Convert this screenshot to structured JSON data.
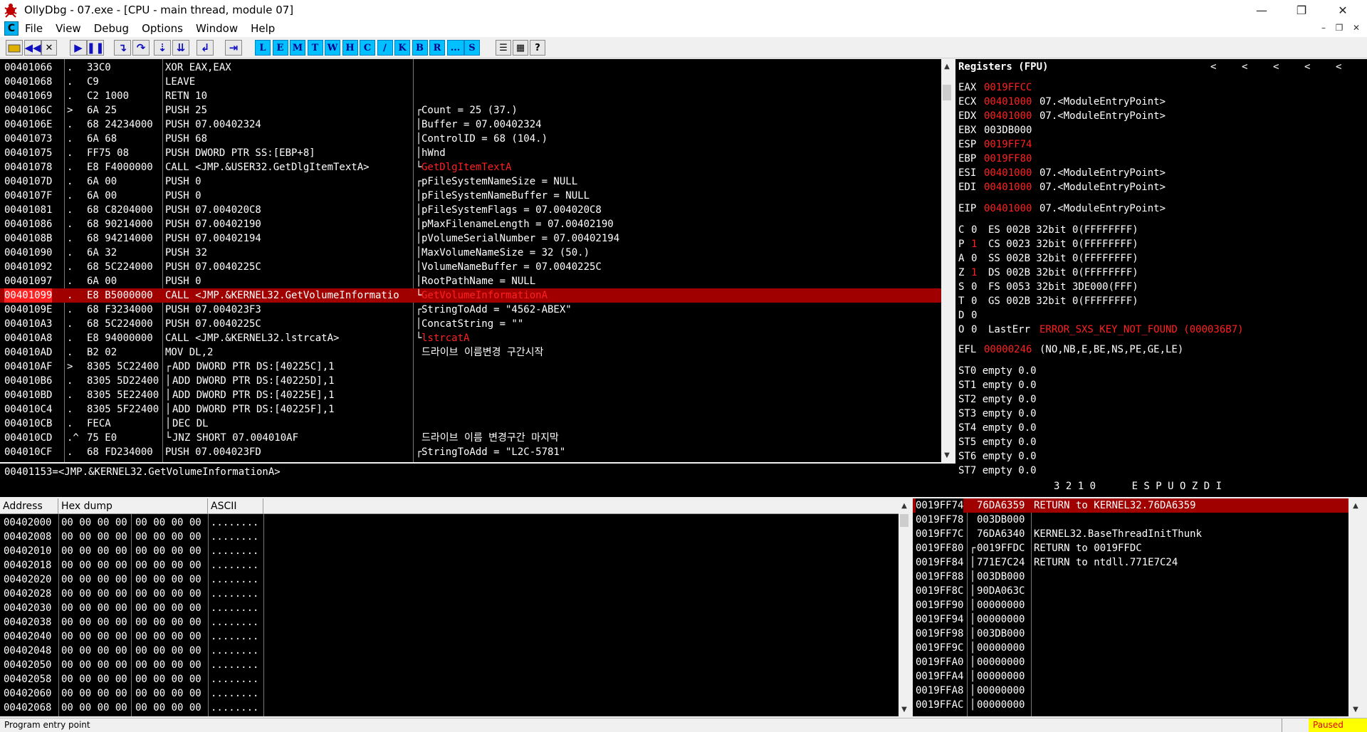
{
  "window": {
    "title": "OllyDbg - 07.exe - [CPU - main thread, module 07]",
    "minimize": "—",
    "restore": "❐",
    "close": "✕"
  },
  "menu": {
    "icon_letter": "C",
    "items": [
      "File",
      "View",
      "Debug",
      "Options",
      "Window",
      "Help"
    ],
    "mdi": [
      "–",
      "❐",
      "✕"
    ]
  },
  "toolbar": {
    "letters": [
      "L",
      "E",
      "M",
      "T",
      "W",
      "H",
      "C",
      "/",
      "K",
      "B",
      "R",
      "...",
      "S"
    ],
    "help": "?"
  },
  "disasm": {
    "rows": [
      {
        "addr": "00401066",
        "m": ".",
        "hex": "33C0",
        "asm": "XOR EAX,EAX",
        "cmt": ""
      },
      {
        "addr": "00401068",
        "m": ".",
        "hex": "C9",
        "asm": "LEAVE",
        "cmt": ""
      },
      {
        "addr": "00401069",
        "m": ".",
        "hex": "C2 1000",
        "asm": "RETN 10",
        "cmt": ""
      },
      {
        "addr": "0040106C",
        "m": ">",
        "hex": "6A 25",
        "asm": "PUSH 25",
        "cmt": "Count = 25 (37.)",
        "br": "┌"
      },
      {
        "addr": "0040106E",
        "m": ".",
        "hex": "68 24234000",
        "asm": "PUSH 07.00402324",
        "cmt": "Buffer = 07.00402324",
        "br": "│",
        "u": true
      },
      {
        "addr": "00401073",
        "m": ".",
        "hex": "6A 68",
        "asm": "PUSH 68",
        "cmt": "ControlID = 68 (104.)",
        "br": "│"
      },
      {
        "addr": "00401075",
        "m": ".",
        "hex": "FF75 08",
        "asm": "PUSH DWORD PTR SS:[EBP+8]",
        "cmt": "hWnd",
        "br": "│"
      },
      {
        "addr": "00401078",
        "m": ".",
        "hex": "E8 F4000000",
        "asm": "CALL <JMP.&USER32.GetDlgItemTextA>",
        "cmt": "GetDlgItemTextA",
        "br": "└",
        "red": true
      },
      {
        "addr": "0040107D",
        "m": ".",
        "hex": "6A 00",
        "asm": "PUSH 0",
        "cmt": "pFileSystemNameSize = NULL",
        "br": "┌"
      },
      {
        "addr": "0040107F",
        "m": ".",
        "hex": "6A 00",
        "asm": "PUSH 0",
        "cmt": "pFileSystemNameBuffer = NULL",
        "br": "│"
      },
      {
        "addr": "00401081",
        "m": ".",
        "hex": "68 C8204000",
        "asm": "PUSH 07.004020C8",
        "cmt": "pFileSystemFlags = 07.004020C8",
        "br": "│",
        "u": true
      },
      {
        "addr": "00401086",
        "m": ".",
        "hex": "68 90214000",
        "asm": "PUSH 07.00402190",
        "cmt": "pMaxFilenameLength = 07.00402190",
        "br": "│",
        "u": true
      },
      {
        "addr": "0040108B",
        "m": ".",
        "hex": "68 94214000",
        "asm": "PUSH 07.00402194",
        "cmt": "pVolumeSerialNumber = 07.00402194",
        "br": "│",
        "u": true
      },
      {
        "addr": "00401090",
        "m": ".",
        "hex": "6A 32",
        "asm": "PUSH 32",
        "cmt": "MaxVolumeNameSize = 32 (50.)",
        "br": "│"
      },
      {
        "addr": "00401092",
        "m": ".",
        "hex": "68 5C224000",
        "asm": "PUSH 07.0040225C",
        "cmt": "VolumeNameBuffer = 07.0040225C",
        "br": "│",
        "u": true
      },
      {
        "addr": "00401097",
        "m": ".",
        "hex": "6A 00",
        "asm": "PUSH 0",
        "cmt": "RootPathName = NULL",
        "br": "│"
      },
      {
        "addr": "00401099",
        "m": ".",
        "hex": "E8 B5000000",
        "asm": "CALL <JMP.&KERNEL32.GetVolumeInformatio",
        "cmt": "GetVolumeInformationA",
        "br": "└",
        "sel": true
      },
      {
        "addr": "0040109E",
        "m": ".",
        "hex": "68 F3234000",
        "asm": "PUSH 07.004023F3",
        "cmt": "StringToAdd = \"4562-ABEX\"",
        "br": "┌",
        "u": true
      },
      {
        "addr": "004010A3",
        "m": ".",
        "hex": "68 5C224000",
        "asm": "PUSH 07.0040225C",
        "cmt": "ConcatString = \"\"",
        "br": "│",
        "u": true
      },
      {
        "addr": "004010A8",
        "m": ".",
        "hex": "E8 94000000",
        "asm": "CALL <JMP.&KERNEL32.lstrcatA>",
        "cmt": "lstrcatA",
        "br": "└",
        "red": true
      },
      {
        "addr": "004010AD",
        "m": ".",
        "hex": "B2 02",
        "asm": "MOV DL,2",
        "cmt": "드라이브 이름변경 구간시작"
      },
      {
        "addr": "004010AF",
        "m": ">",
        "hex": "8305 5C22400",
        "asm": "ADD DWORD PTR DS:[40225C],1",
        "cmt": "",
        "lb": "┌",
        "u": true
      },
      {
        "addr": "004010B6",
        "m": ".",
        "hex": "8305 5D22400",
        "asm": "ADD DWORD PTR DS:[40225D],1",
        "cmt": "",
        "lb": "│",
        "u": true
      },
      {
        "addr": "004010BD",
        "m": ".",
        "hex": "8305 5E22400",
        "asm": "ADD DWORD PTR DS:[40225E],1",
        "cmt": "",
        "lb": "│",
        "u": true
      },
      {
        "addr": "004010C4",
        "m": ".",
        "hex": "8305 5F22400",
        "asm": "ADD DWORD PTR DS:[40225F],1",
        "cmt": "",
        "lb": "│",
        "u": true
      },
      {
        "addr": "004010CB",
        "m": ".",
        "hex": "FECA",
        "asm": "DEC DL",
        "cmt": "",
        "lb": "│"
      },
      {
        "addr": "004010CD",
        "m": ".^",
        "hex": "75 E0",
        "asm": "JNZ SHORT 07.004010AF",
        "cmt": "드라이브 이름 변경구간 마지막",
        "lb": "└"
      },
      {
        "addr": "004010CF",
        "m": ".",
        "hex": "68 FD234000",
        "asm": "PUSH 07.004023FD",
        "cmt": "StringToAdd = \"L2C-5781\"",
        "br": "┌",
        "u": true
      }
    ],
    "info": "00401153=<JMP.&KERNEL32.GetVolumeInformationA>"
  },
  "registers": {
    "header": "Registers (FPU)",
    "nav": [
      "<",
      "<",
      "<",
      "<",
      "<"
    ],
    "gpr": [
      {
        "n": "EAX",
        "v": "0019FFCC",
        "red": true,
        "c": ""
      },
      {
        "n": "ECX",
        "v": "00401000",
        "red": true,
        "c": "07.<ModuleEntryPoint>"
      },
      {
        "n": "EDX",
        "v": "00401000",
        "red": true,
        "c": "07.<ModuleEntryPoint>"
      },
      {
        "n": "EBX",
        "v": "003DB000",
        "red": false,
        "c": ""
      },
      {
        "n": "ESP",
        "v": "0019FF74",
        "red": true,
        "c": ""
      },
      {
        "n": "EBP",
        "v": "0019FF80",
        "red": true,
        "c": ""
      },
      {
        "n": "ESI",
        "v": "00401000",
        "red": true,
        "c": "07.<ModuleEntryPoint>"
      },
      {
        "n": "EDI",
        "v": "00401000",
        "red": true,
        "c": "07.<ModuleEntryPoint>"
      }
    ],
    "eip": {
      "n": "EIP",
      "v": "00401000",
      "c": "07.<ModuleEntryPoint>"
    },
    "flags": [
      {
        "f": "C",
        "v": "0",
        "red": false,
        "s": "ES 002B 32bit 0(FFFFFFFF)"
      },
      {
        "f": "P",
        "v": "1",
        "red": true,
        "s": "CS 0023 32bit 0(FFFFFFFF)"
      },
      {
        "f": "A",
        "v": "0",
        "red": false,
        "s": "SS 002B 32bit 0(FFFFFFFF)"
      },
      {
        "f": "Z",
        "v": "1",
        "red": true,
        "s": "DS 002B 32bit 0(FFFFFFFF)"
      },
      {
        "f": "S",
        "v": "0",
        "red": false,
        "s": "FS 0053 32bit 3DE000(FFF)"
      },
      {
        "f": "T",
        "v": "0",
        "red": false,
        "s": "GS 002B 32bit 0(FFFFFFFF)"
      },
      {
        "f": "D",
        "v": "0",
        "red": false,
        "s": ""
      }
    ],
    "lasterr": {
      "f": "O",
      "v": "0",
      "label": "LastErr",
      "err": "ERROR_SXS_KEY_NOT_FOUND (000036B7)"
    },
    "efl": {
      "n": "EFL",
      "v": "00000246",
      "c": "(NO,NB,E,BE,NS,PE,GE,LE)"
    },
    "fpu": [
      "ST0 empty 0.0",
      "ST1 empty 0.0",
      "ST2 empty 0.0",
      "ST3 empty 0.0",
      "ST4 empty 0.0",
      "ST5 empty 0.0",
      "ST6 empty 0.0",
      "ST7 empty 0.0"
    ],
    "fpu_footer": "3 2 1 0      E S P U O Z D I"
  },
  "dump": {
    "headers": {
      "address": "Address",
      "hex": "Hex dump",
      "ascii": "ASCII"
    },
    "rows": [
      {
        "a": "00402000",
        "h1": "00 00 00 00",
        "h2": "00 00 00 00",
        "s": "........"
      },
      {
        "a": "00402008",
        "h1": "00 00 00 00",
        "h2": "00 00 00 00",
        "s": "........"
      },
      {
        "a": "00402010",
        "h1": "00 00 00 00",
        "h2": "00 00 00 00",
        "s": "........"
      },
      {
        "a": "00402018",
        "h1": "00 00 00 00",
        "h2": "00 00 00 00",
        "s": "........"
      },
      {
        "a": "00402020",
        "h1": "00 00 00 00",
        "h2": "00 00 00 00",
        "s": "........"
      },
      {
        "a": "00402028",
        "h1": "00 00 00 00",
        "h2": "00 00 00 00",
        "s": "........"
      },
      {
        "a": "00402030",
        "h1": "00 00 00 00",
        "h2": "00 00 00 00",
        "s": "........"
      },
      {
        "a": "00402038",
        "h1": "00 00 00 00",
        "h2": "00 00 00 00",
        "s": "........"
      },
      {
        "a": "00402040",
        "h1": "00 00 00 00",
        "h2": "00 00 00 00",
        "s": "........"
      },
      {
        "a": "00402048",
        "h1": "00 00 00 00",
        "h2": "00 00 00 00",
        "s": "........"
      },
      {
        "a": "00402050",
        "h1": "00 00 00 00",
        "h2": "00 00 00 00",
        "s": "........"
      },
      {
        "a": "00402058",
        "h1": "00 00 00 00",
        "h2": "00 00 00 00",
        "s": "........"
      },
      {
        "a": "00402060",
        "h1": "00 00 00 00",
        "h2": "00 00 00 00",
        "s": "........"
      },
      {
        "a": "00402068",
        "h1": "00 00 00 00",
        "h2": "00 00 00 00",
        "s": "........"
      }
    ]
  },
  "stack": {
    "rows": [
      {
        "a": "0019FF74",
        "v": "76DA6359",
        "c": "RETURN to KERNEL32.76DA6359",
        "sel": true,
        "m": ""
      },
      {
        "a": "0019FF78",
        "v": "003DB000",
        "c": "",
        "m": ""
      },
      {
        "a": "0019FF7C",
        "v": "76DA6340",
        "c": "KERNEL32.BaseThreadInitThunk",
        "m": ""
      },
      {
        "a": "0019FF80",
        "v": "0019FFDC",
        "c": "RETURN to 0019FFDC",
        "m": "┌"
      },
      {
        "a": "0019FF84",
        "v": "771E7C24",
        "c": "RETURN to ntdll.771E7C24",
        "m": "│"
      },
      {
        "a": "0019FF88",
        "v": "003DB000",
        "c": "",
        "m": "│"
      },
      {
        "a": "0019FF8C",
        "v": "90DA063C",
        "c": "",
        "m": "│"
      },
      {
        "a": "0019FF90",
        "v": "00000000",
        "c": "",
        "m": "│"
      },
      {
        "a": "0019FF94",
        "v": "00000000",
        "c": "",
        "m": "│"
      },
      {
        "a": "0019FF98",
        "v": "003DB000",
        "c": "",
        "m": "│"
      },
      {
        "a": "0019FF9C",
        "v": "00000000",
        "c": "",
        "m": "│"
      },
      {
        "a": "0019FFA0",
        "v": "00000000",
        "c": "",
        "m": "│"
      },
      {
        "a": "0019FFA4",
        "v": "00000000",
        "c": "",
        "m": "│"
      },
      {
        "a": "0019FFA8",
        "v": "00000000",
        "c": "",
        "m": "│"
      },
      {
        "a": "0019FFAC",
        "v": "00000000",
        "c": "",
        "m": "│"
      }
    ]
  },
  "status": {
    "left": "Program entry point",
    "right": "Paused"
  },
  "colors": {
    "red": "#ff2020",
    "selected": "#a00000",
    "accent": "#00c0ff",
    "paused_bg": "#ffff00"
  }
}
